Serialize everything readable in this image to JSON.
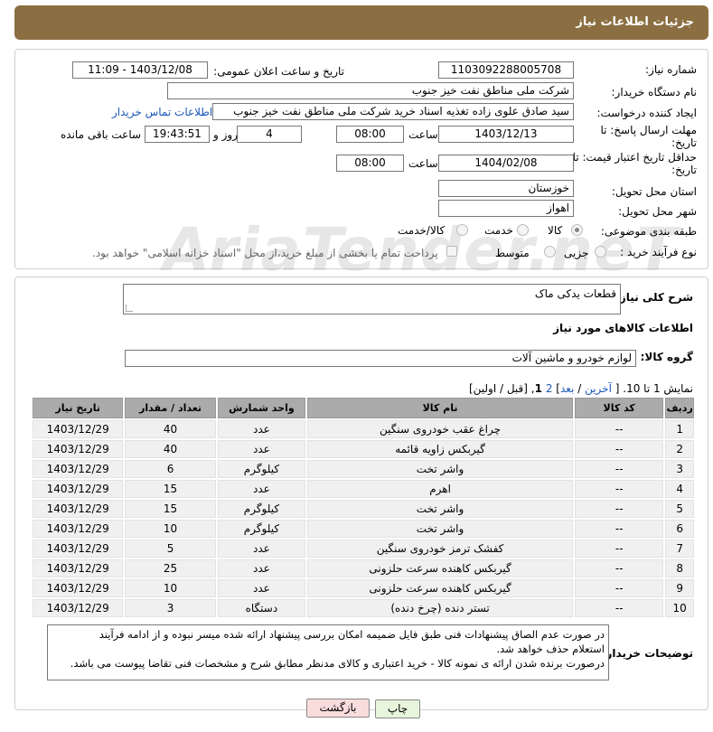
{
  "header": {
    "title": "جزئیات اطلاعات نیاز"
  },
  "form": {
    "need_number_label": "شماره نیاز:",
    "need_number": "1103092288005708",
    "announce_label": "تاریخ و ساعت اعلان عمومی:",
    "announce_value": "1403/12/08 - 11:09",
    "buyer_org_label": "نام دستگاه خریدار:",
    "buyer_org": "شرکت ملی مناطق نفت خیز جنوب",
    "creator_label": "ایجاد کننده درخواست:",
    "creator": "سید صادق علوی زاده  تغذیه اسناد خرید  شرکت ملی مناطق نفت خیز جنوب",
    "contact_link": "اطلاعات تماس خریدار",
    "deadline_label_1": "مهلت ارسال پاسخ: تا",
    "deadline_label_2": "تاریخ:",
    "deadline_date": "1403/12/13",
    "time_label": "ساعت",
    "deadline_time": "08:00",
    "days_value": "4",
    "days_label": "روز و",
    "remaining_time": "19:43:51",
    "remaining_label": "ساعت باقی مانده",
    "validity_label_1": "حداقل تاریخ اعتبار قیمت: تا",
    "validity_label_2": "تاریخ:",
    "validity_date": "1404/02/08",
    "validity_time": "08:00",
    "province_label": "استان محل تحویل:",
    "province": "خوزستان",
    "city_label": "شهر محل تحویل:",
    "city": "اهواز",
    "category_label": "طبقه بندی موضوعی:",
    "category_options": [
      "کالا",
      "خدمت",
      "کالا/خدمت"
    ],
    "category_selected": "کالا",
    "process_label": "نوع فرآیند خرید :",
    "process_options": [
      "جزیی",
      "متوسط"
    ],
    "payment_note": "پرداخت تمام یا بخشی از مبلغ خرید،از محل \"اسناد خزانه اسلامی\" خواهد بود."
  },
  "details": {
    "description_label": "شرح کلی نیاز:",
    "description": "قطعات یدکی ماک",
    "goods_info_title": "اطلاعات کالاهای مورد نیاز",
    "goods_group_label": "گروه کالا:",
    "goods_group": "لوازم خودرو و ماشین آلات",
    "pager": {
      "prefix": "نمایش 1 تا 10. [",
      "last": "آخرین",
      "sep1": " / ",
      "next": "بعد",
      "page2": "2",
      "current": "1",
      "suffix": "[قبل / اولین]"
    },
    "table": {
      "headers": [
        "ردیف",
        "کد کالا",
        "نام کالا",
        "واحد شمارش",
        "تعداد / مقدار",
        "تاریخ نیاز"
      ],
      "rows": [
        [
          "1",
          "--",
          "چراغ عقب خودروی سنگین",
          "عدد",
          "40",
          "1403/12/29"
        ],
        [
          "2",
          "--",
          "گیربکس زاویه قائمه",
          "عدد",
          "40",
          "1403/12/29"
        ],
        [
          "3",
          "--",
          "واشر تخت",
          "کیلوگرم",
          "6",
          "1403/12/29"
        ],
        [
          "4",
          "--",
          "اهرم",
          "عدد",
          "15",
          "1403/12/29"
        ],
        [
          "5",
          "--",
          "واشر تخت",
          "کیلوگرم",
          "15",
          "1403/12/29"
        ],
        [
          "6",
          "--",
          "واشر تخت",
          "کیلوگرم",
          "10",
          "1403/12/29"
        ],
        [
          "7",
          "--",
          "کفشک ترمز خودروی سنگین",
          "عدد",
          "5",
          "1403/12/29"
        ],
        [
          "8",
          "--",
          "گیربکس کاهنده سرعت حلزونی",
          "عدد",
          "25",
          "1403/12/29"
        ],
        [
          "9",
          "--",
          "گیربکس کاهنده سرعت حلزونی",
          "عدد",
          "10",
          "1403/12/29"
        ],
        [
          "10",
          "--",
          "تستر دنده (چرخ دنده)",
          "دستگاه",
          "3",
          "1403/12/29"
        ]
      ]
    },
    "buyer_notes_label": "توضیحات خریدار:",
    "buyer_notes_line1": "در صورت عدم الصاق پیشنهادات فنی طبق فایل ضمیمه امکان بررسی پیشنهاد ارائه شده میسر نبوده و از ادامه فرآیند",
    "buyer_notes_line2": "استعلام حذف خواهد شد.",
    "buyer_notes_line3": "درصورت برنده شدن ارائه ی نمونه کالا - خرید اعتباری و کالای مدنظر مطابق شرح و مشخصات فنی تقاضا پیوست می باشد."
  },
  "buttons": {
    "print": "چاپ",
    "back": "بازگشت"
  },
  "watermark": "AriaTender.neT",
  "colors": {
    "header": "#8b6f43",
    "link": "#1a57b8",
    "back_button": "#f9dcdc",
    "print_button": "#e6f5dc"
  }
}
